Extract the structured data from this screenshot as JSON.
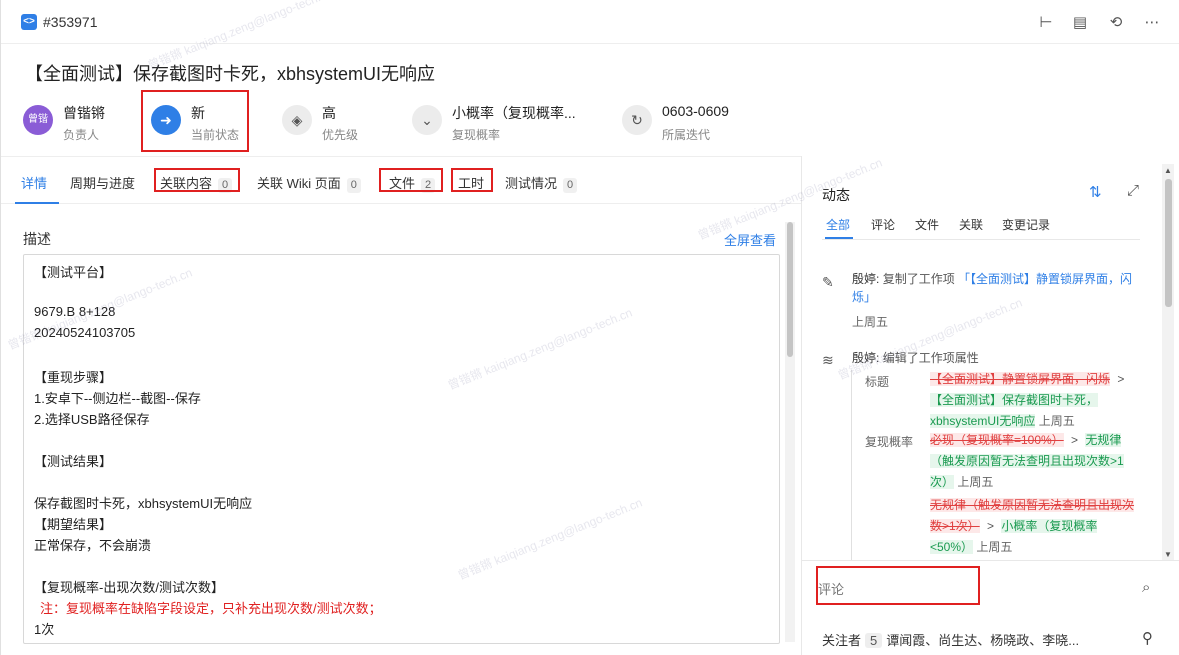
{
  "header": {
    "item_id": "#353971",
    "tool_icons": [
      "hierarchy-icon",
      "clipboard-icon",
      "assign-icon",
      "more-icon"
    ]
  },
  "title": "【全面测试】保存截图时卡死，xbhsystemUI无响应",
  "fields": {
    "owner": {
      "avatar": "曾锴",
      "value": "曾锴锵",
      "label": "负责人"
    },
    "status": {
      "value": "新",
      "label": "当前状态"
    },
    "priority": {
      "value": "高",
      "label": "优先级"
    },
    "repro": {
      "value": "小概率（复现概率...",
      "label": "复现概率"
    },
    "iteration": {
      "value": "0603-0609",
      "label": "所属迭代"
    }
  },
  "tabs": [
    {
      "label": "详情",
      "count": ""
    },
    {
      "label": "周期与进度",
      "count": ""
    },
    {
      "label": "关联内容",
      "count": "0"
    },
    {
      "label": "关联 Wiki 页面",
      "count": "0"
    },
    {
      "label": "文件",
      "count": "2"
    },
    {
      "label": "工时",
      "count": ""
    },
    {
      "label": "测试情况",
      "count": "0"
    }
  ],
  "description": {
    "label": "描述",
    "fullscreen": "全屏查看",
    "lines": [
      "【测试平台】",
      "",
      "9679.B 8+128",
      "20240524103705",
      "",
      "【重现步骤】",
      "1.安卓下--侧边栏--截图--保存",
      "2.选择USB路径保存",
      "",
      "【测试结果】",
      "",
      "保存截图时卡死，xbhsystemUI无响应",
      "【期望结果】",
      "正常保存，不会崩溃",
      "",
      "【复现概率-出现次数/测试次数】",
      "注：复现概率在缺陷字段设定，只补充出现次数/测试次数；",
      "1次"
    ]
  },
  "activity": {
    "title": "动态",
    "tabs": [
      "全部",
      "评论",
      "文件",
      "关联",
      "变更记录"
    ],
    "items": [
      {
        "who": "殷婷:",
        "action": "复制了工作项",
        "link": "「【全面测试】静置锁屏界面，闪烁」",
        "time": "上周五"
      },
      {
        "who": "殷婷:",
        "action": "编辑了工作项属性"
      }
    ],
    "changes": {
      "title_label": "标题",
      "title_old": "【全面测试】静置锁屏界面，闪烁",
      "title_new": "【全面测试】保存截图时卡死，xbhsystemUI无响应",
      "title_time": "上周五",
      "repro_label": "复现概率",
      "repro_old1": "必现（复现概率=100%）",
      "repro_new1": "无规律（触发原因暂无法查明且出现次数>1次）",
      "repro_time1": "上周五",
      "repro_old2": "无规律（触发原因暂无法查明且出现次数>1次）",
      "repro_new2": "小概率（复现概率<50%）",
      "repro_time2": "上周五"
    }
  },
  "comment": {
    "placeholder": "评论"
  },
  "followers": {
    "label": "关注者",
    "count": "5",
    "names": "谭闻霞、尚生达、杨晓政、李晓..."
  },
  "watermark": "曾锴锵 kaiqiang.zeng@lango-tech.cn",
  "colors": {
    "accent": "#2f7fe6",
    "annotation_red": "#e02020",
    "added_green": "#1a9a50",
    "removed_red": "#e04040"
  }
}
